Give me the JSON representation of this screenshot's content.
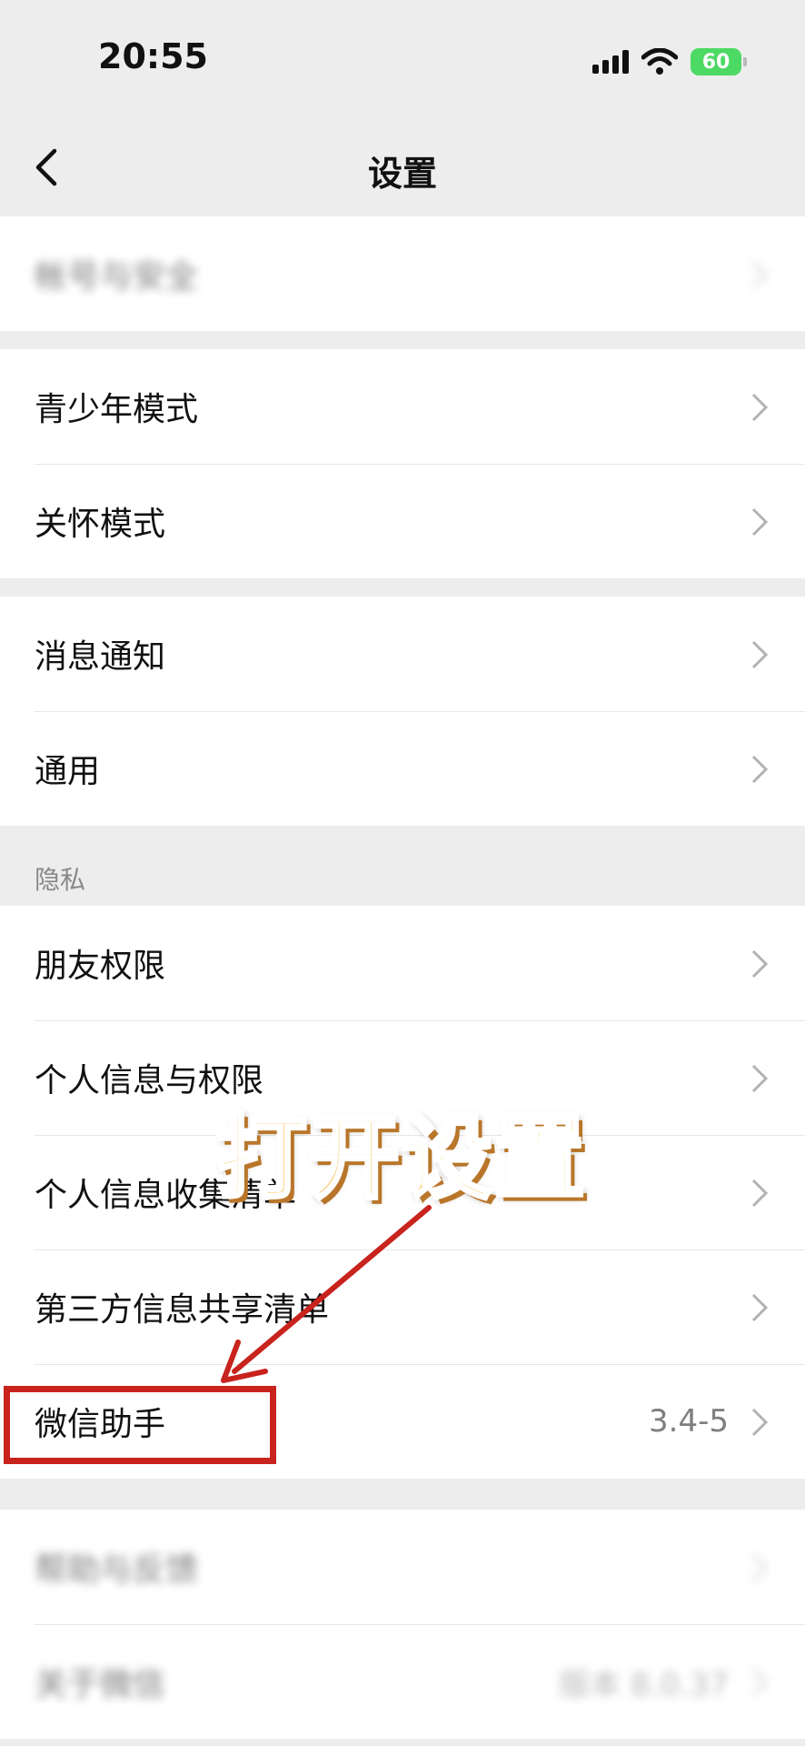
{
  "status_bar": {
    "time": "20:55",
    "battery": "60"
  },
  "nav": {
    "title": "设置"
  },
  "group1": {
    "items": [
      {
        "label": "帐号与安全"
      }
    ]
  },
  "group2": {
    "items": [
      {
        "label": "青少年模式"
      },
      {
        "label": "关怀模式"
      }
    ]
  },
  "group3": {
    "items": [
      {
        "label": "消息通知"
      },
      {
        "label": "通用"
      }
    ]
  },
  "privacy": {
    "header": "隐私",
    "items": [
      {
        "label": "朋友权限"
      },
      {
        "label": "个人信息与权限"
      },
      {
        "label": "个人信息收集清单"
      },
      {
        "label": "第三方信息共享清单"
      },
      {
        "label": "微信助手",
        "value": "3.4-5"
      }
    ]
  },
  "group5": {
    "items": [
      {
        "label": "帮助与反馈"
      },
      {
        "label": "关于微信",
        "value": "版本 8.0.37"
      }
    ]
  },
  "overlay": {
    "caption": "打开设置"
  },
  "colors": {
    "accent_red": "#c8231d",
    "battery_green": "#4cd964",
    "caption_gold": "#f7ca6a"
  }
}
